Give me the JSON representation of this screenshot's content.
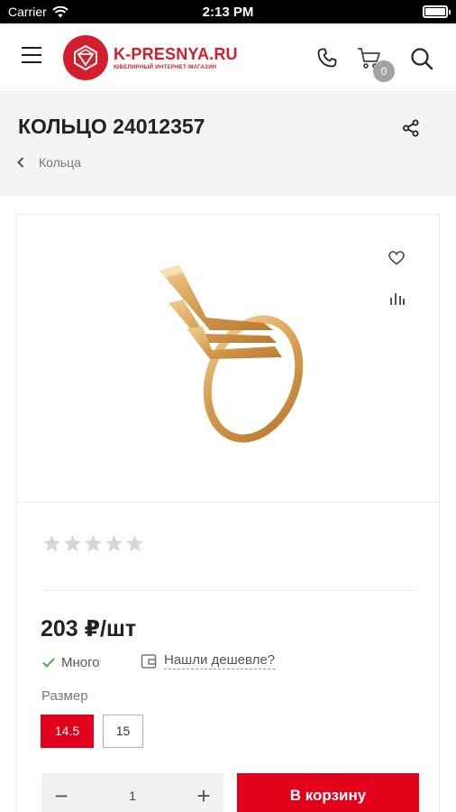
{
  "status_bar": {
    "carrier": "Carrier",
    "time": "2:13 PM"
  },
  "header": {
    "logo_main": "K-PRESNYA.RU",
    "logo_sub": "ЮВЕЛИРНЫЙ ИНТЕРНЕТ-МАГАЗИН",
    "cart_count": "0",
    "icons": [
      "menu-icon",
      "phone-icon",
      "cart-icon",
      "search-icon"
    ]
  },
  "product": {
    "title": "КОЛЬЦО 24012357",
    "breadcrumb": "Кольца",
    "rating": 0,
    "rating_max": 5,
    "price": "203 ₽/шт",
    "stock": "Много",
    "cheaper_link": "Нашли дешевле?",
    "size_label": "Размер",
    "sizes": [
      "14.5",
      "15"
    ],
    "selected_size": "14.5",
    "quantity": "1",
    "qty_minus": "−",
    "qty_plus": "+",
    "add_to_cart": "В корзину"
  },
  "colors": {
    "accent": "#e2001a",
    "logo_red": "#d21f2b",
    "gold": "#d9a55d"
  }
}
